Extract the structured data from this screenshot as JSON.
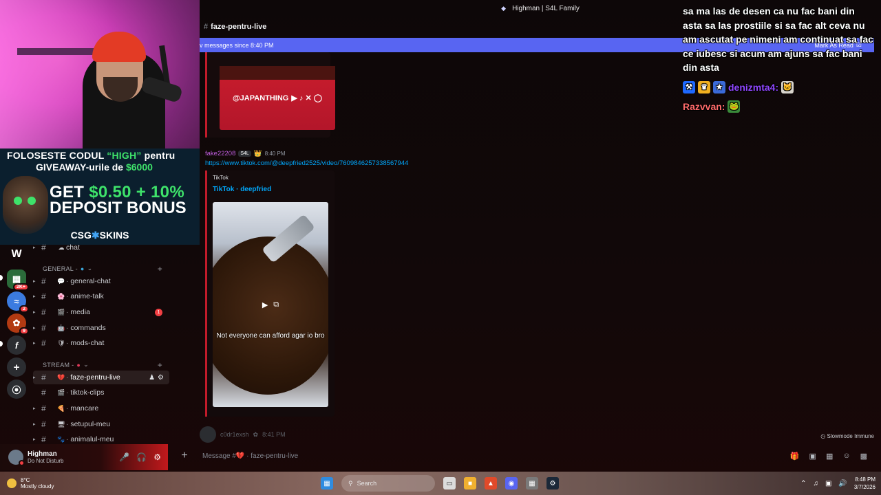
{
  "window": {
    "title": "Highman | S4L Family"
  },
  "channel_header": {
    "name": "faze-pentru-live"
  },
  "new_messages_bar": {
    "text": "v messages since 8:40 PM",
    "action": "Mark As Read"
  },
  "promo": {
    "line1_pre": "FOLOSESTE CODUL ",
    "line1_code": "“HIGH”",
    "line1_post": " pentru",
    "line2_pre": "GIVEAWAY-urile de ",
    "line2_amount": "$6000",
    "big1_pre": "GET ",
    "big1_amount": "$0.50 + 10%",
    "big2": "DEPOSIT BONUS",
    "brand_a": "CSG",
    "brand_b": "SKINS"
  },
  "sidebar": {
    "top_channel": "chat",
    "categories": [
      {
        "label": "GENERAL -"
      },
      {
        "label": "STREAM -"
      }
    ],
    "channels": [
      {
        "label": "general-chat",
        "emoji": "💬"
      },
      {
        "label": "anime-talk",
        "emoji": "🌸"
      },
      {
        "label": "media",
        "emoji": "🎬",
        "badge": "1"
      },
      {
        "label": "commands",
        "emoji": "🤖"
      },
      {
        "label": "mods-chat",
        "emoji": "🛡"
      },
      {
        "label": "faze-pentru-live",
        "emoji": "💔"
      },
      {
        "label": "tiktok-clips",
        "emoji": "🎬"
      },
      {
        "label": "mancare",
        "emoji": "🍕"
      },
      {
        "label": "setupul-meu",
        "emoji": "🖥"
      },
      {
        "label": "animalul-meu",
        "emoji": "🐾"
      }
    ],
    "server_badges": [
      "2K+",
      "2",
      "9"
    ]
  },
  "user_panel": {
    "name": "Highman",
    "status": "Do Not Disturb"
  },
  "messages": {
    "embed_top_text": "@JAPANTHING",
    "msg2_user": "fake22208",
    "msg2_tag": "S4L",
    "msg2_time": "8:40 PM",
    "msg2_link": "https://www.tiktok.com/@deepfried2525/video/7609846257338567944",
    "embed2_provider": "TikTok",
    "embed2_title": "TikTok · deepfried",
    "embed2_caption": "Not everyone can afford agar io bro",
    "next_user": "c0dr1exsh",
    "next_time": "8:41 PM"
  },
  "slowmode": "Slowmode Immune",
  "composer": {
    "placeholder": "Message #💔 · faze-pentru-live"
  },
  "overlay": {
    "message": "sa ma las de desen ca nu fac bani din asta sa las prostiile si sa fac alt ceva nu am ascutat pe nimeni am continuat sa fac ce iubesc si acum am ajuns sa fac bani din asta",
    "user1": "denizmta4:",
    "user2": "Razvvan:"
  },
  "taskbar": {
    "weather_temp": "8°C",
    "weather_desc": "Mostly cloudy",
    "search": "Search",
    "time": "8:48 PM",
    "date": "3/7/2026"
  }
}
